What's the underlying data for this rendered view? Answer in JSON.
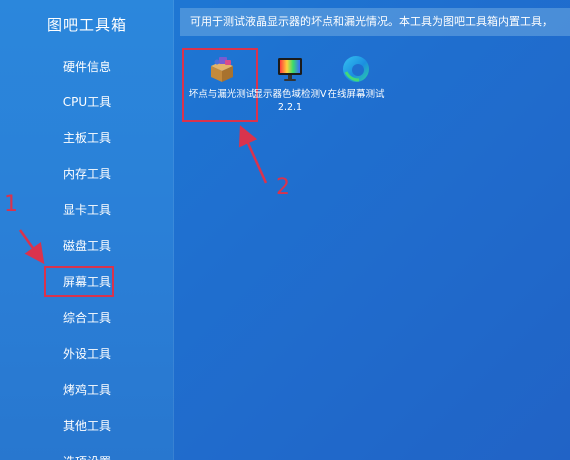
{
  "sidebar": {
    "title": "图吧工具箱",
    "items": [
      {
        "label": "硬件信息"
      },
      {
        "label": "CPU工具"
      },
      {
        "label": "主板工具"
      },
      {
        "label": "内存工具"
      },
      {
        "label": "显卡工具"
      },
      {
        "label": "磁盘工具"
      },
      {
        "label": "屏幕工具"
      },
      {
        "label": "综合工具"
      },
      {
        "label": "外设工具"
      },
      {
        "label": "烤鸡工具"
      },
      {
        "label": "其他工具"
      },
      {
        "label": "选项设置"
      }
    ],
    "selected": "屏幕工具"
  },
  "header": {
    "description": "可用于测试液晶显示器的坏点和漏光情况。本工具为图吧工具箱内置工具，"
  },
  "tools": [
    {
      "label": "坏点与漏光测试",
      "icon": "box-icon"
    },
    {
      "label": "显示器色域检测V2.2.1",
      "icon": "monitor-icon"
    },
    {
      "label": "在线屏幕测试",
      "icon": "edge-browser-icon"
    }
  ],
  "annotations": {
    "step1": "1",
    "step2": "2",
    "color": "#d9334d"
  },
  "colors": {
    "background": "#1f6fcf",
    "sidebar": "#2a7ed6",
    "highlight": "#d9334d"
  }
}
